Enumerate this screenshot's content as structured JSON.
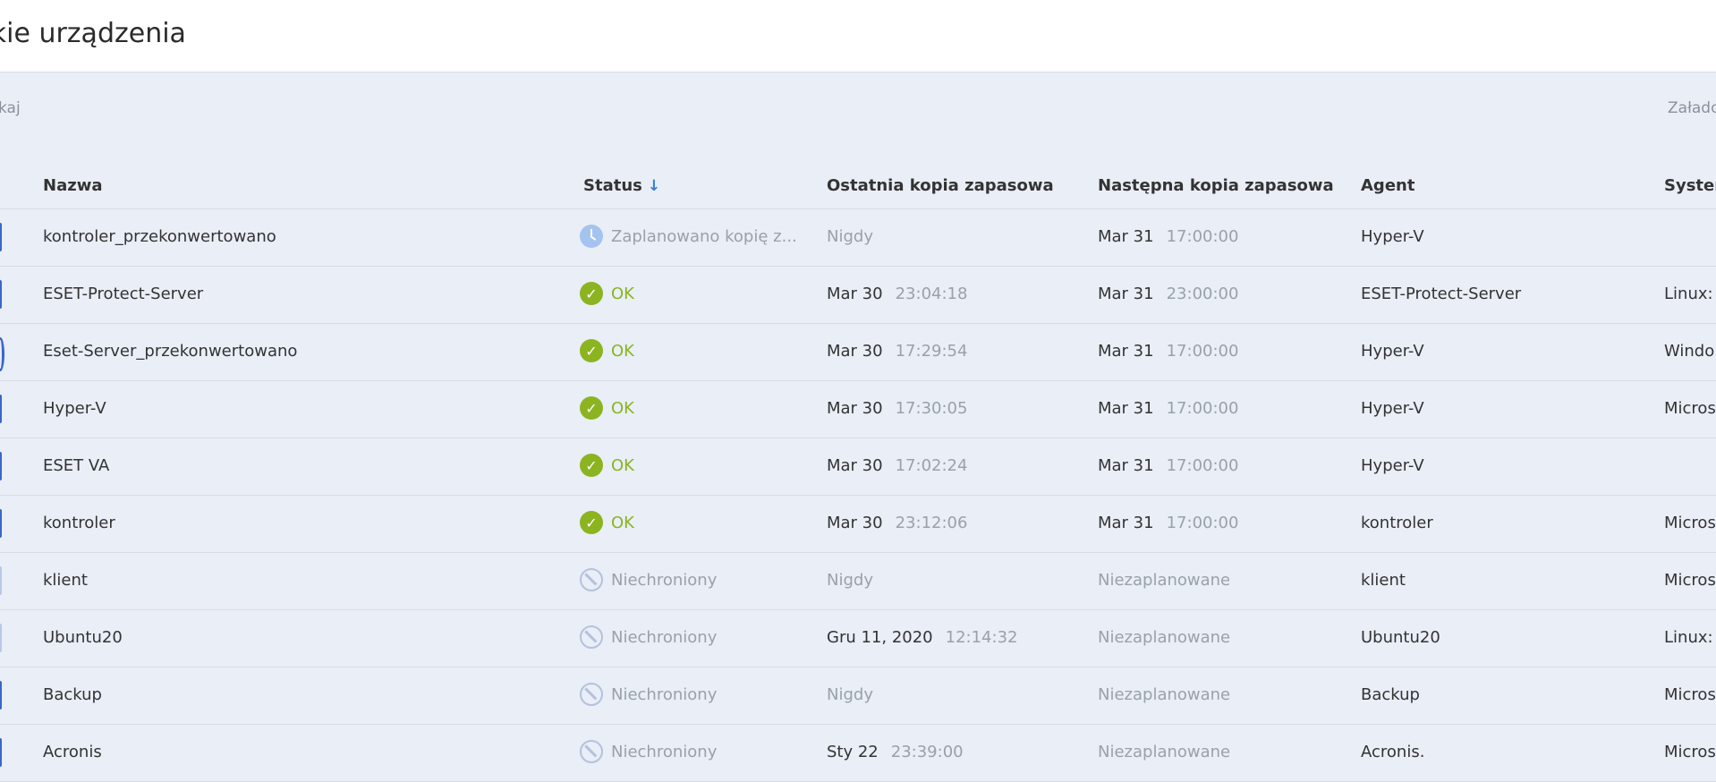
{
  "page": {
    "title": "tkie urządzenia"
  },
  "toolbar": {
    "search_placeholder": "kaj",
    "loaded_label": "Załado"
  },
  "table": {
    "columns": {
      "name": "Nazwa",
      "status": "Status",
      "last_backup": "Ostatnia kopia zapasowa",
      "next_backup": "Następna kopia zapasowa",
      "agent": "Agent",
      "system": "Systen"
    },
    "rows": [
      {
        "name": "kontroler_przekonwertowano",
        "status": "Zaplanowano kopię z...",
        "status_icon": "clock-icon",
        "last_date": "Nigdy",
        "last_time": "",
        "next_date": "Mar 31",
        "next_time": "17:00:00",
        "agent": "Hyper-V",
        "system": ""
      },
      {
        "name": "ESET-Protect-Server",
        "status": "OK",
        "status_icon": "check-icon",
        "last_date": "Mar 30",
        "last_time": "23:04:18",
        "next_date": "Mar 31",
        "next_time": "23:00:00",
        "agent": "ESET-Protect-Server",
        "system": "Linux:"
      },
      {
        "name": "Eset-Server_przekonwertowano",
        "status": "OK",
        "status_icon": "check-icon",
        "last_date": "Mar 30",
        "last_time": "17:29:54",
        "next_date": "Mar 31",
        "next_time": "17:00:00",
        "agent": "Hyper-V",
        "system": "Windo"
      },
      {
        "name": "Hyper-V",
        "status": "OK",
        "status_icon": "check-icon",
        "last_date": "Mar 30",
        "last_time": "17:30:05",
        "next_date": "Mar 31",
        "next_time": "17:00:00",
        "agent": "Hyper-V",
        "system": "Micros"
      },
      {
        "name": "ESET VA",
        "status": "OK",
        "status_icon": "check-icon",
        "last_date": "Mar 30",
        "last_time": "17:02:24",
        "next_date": "Mar 31",
        "next_time": "17:00:00",
        "agent": "Hyper-V",
        "system": ""
      },
      {
        "name": "kontroler",
        "status": "OK",
        "status_icon": "check-icon",
        "last_date": "Mar 30",
        "last_time": "23:12:06",
        "next_date": "Mar 31",
        "next_time": "17:00:00",
        "agent": "kontroler",
        "system": "Micros"
      },
      {
        "name": "klient",
        "status": "Niechroniony",
        "status_icon": "ban-icon",
        "last_date": "Nigdy",
        "last_time": "",
        "next_date": "Niezaplanowane",
        "next_time": "",
        "agent": "klient",
        "system": "Micros"
      },
      {
        "name": "Ubuntu20",
        "status": "Niechroniony",
        "status_icon": "ban-icon",
        "last_date": "Gru 11, 2020",
        "last_time": "12:14:32",
        "next_date": "Niezaplanowane",
        "next_time": "",
        "agent": "Ubuntu20",
        "system": "Linux:"
      },
      {
        "name": "Backup",
        "status": "Niechroniony",
        "status_icon": "ban-icon",
        "last_date": "Nigdy",
        "last_time": "",
        "next_date": "Niezaplanowane",
        "next_time": "",
        "agent": "Backup",
        "system": "Micros"
      },
      {
        "name": "Acronis",
        "status": "Niechroniony",
        "status_icon": "ban-icon",
        "last_date": "Sty 22",
        "last_time": "23:39:00",
        "next_date": "Niezaplanowane",
        "next_time": "",
        "agent": "Acronis.",
        "system": "Micros"
      }
    ]
  },
  "colors": {
    "accent": "#3a7bd5",
    "ok": "#8bb420",
    "muted": "#9aa1ab",
    "background": "#e9eef7"
  }
}
